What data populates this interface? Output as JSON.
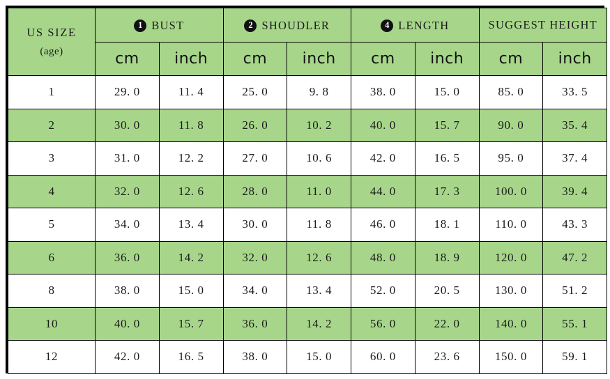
{
  "table": {
    "title": "US SIZE chart",
    "accent_color": "#a7d68b",
    "border_color": "#000000",
    "text_color": "#1a1a1a",
    "size_column": {
      "line1": "US SIZE",
      "line2": "(age)"
    },
    "measurement_groups": [
      {
        "badge": "1",
        "label": "BUST"
      },
      {
        "badge": "2",
        "label": "SHOUDLER"
      },
      {
        "badge": "4",
        "label": "LENGTH"
      },
      {
        "badge": "",
        "label": "SUGGEST HEIGHT"
      }
    ],
    "unit_headers": [
      "cm",
      "inch",
      "cm",
      "inch",
      "cm",
      "inch",
      "cm",
      "inch"
    ],
    "rows": [
      {
        "size": "1",
        "striped": false,
        "values": [
          "29. 0",
          "11. 4",
          "25. 0",
          "9. 8",
          "38. 0",
          "15. 0",
          "85. 0",
          "33. 5"
        ]
      },
      {
        "size": "2",
        "striped": true,
        "values": [
          "30. 0",
          "11. 8",
          "26. 0",
          "10. 2",
          "40. 0",
          "15. 7",
          "90. 0",
          "35. 4"
        ]
      },
      {
        "size": "3",
        "striped": false,
        "values": [
          "31. 0",
          "12. 2",
          "27. 0",
          "10. 6",
          "42. 0",
          "16. 5",
          "95. 0",
          "37. 4"
        ]
      },
      {
        "size": "4",
        "striped": true,
        "values": [
          "32. 0",
          "12. 6",
          "28. 0",
          "11. 0",
          "44. 0",
          "17. 3",
          "100. 0",
          "39. 4"
        ]
      },
      {
        "size": "5",
        "striped": false,
        "values": [
          "34. 0",
          "13. 4",
          "30. 0",
          "11. 8",
          "46. 0",
          "18. 1",
          "110. 0",
          "43. 3"
        ]
      },
      {
        "size": "6",
        "striped": true,
        "values": [
          "36. 0",
          "14. 2",
          "32. 0",
          "12. 6",
          "48. 0",
          "18. 9",
          "120. 0",
          "47. 2"
        ]
      },
      {
        "size": "8",
        "striped": false,
        "values": [
          "38. 0",
          "15. 0",
          "34. 0",
          "13. 4",
          "52. 0",
          "20. 5",
          "130. 0",
          "51. 2"
        ]
      },
      {
        "size": "10",
        "striped": true,
        "values": [
          "40. 0",
          "15. 7",
          "36. 0",
          "14. 2",
          "56. 0",
          "22. 0",
          "140. 0",
          "55. 1"
        ]
      },
      {
        "size": "12",
        "striped": false,
        "values": [
          "42. 0",
          "16. 5",
          "38. 0",
          "15. 0",
          "60. 0",
          "23. 6",
          "150. 0",
          "59. 1"
        ]
      }
    ]
  },
  "chart_data": {
    "type": "table",
    "title": "US SIZE chart",
    "columns": [
      "US SIZE (age)",
      "BUST cm",
      "BUST inch",
      "SHOUDLER cm",
      "SHOUDLER inch",
      "LENGTH cm",
      "LENGTH inch",
      "SUGGEST HEIGHT cm",
      "SUGGEST HEIGHT inch"
    ],
    "rows": [
      [
        "1",
        29.0,
        11.4,
        25.0,
        9.8,
        38.0,
        15.0,
        85.0,
        33.5
      ],
      [
        "2",
        30.0,
        11.8,
        26.0,
        10.2,
        40.0,
        15.7,
        90.0,
        35.4
      ],
      [
        "3",
        31.0,
        12.2,
        27.0,
        10.6,
        42.0,
        16.5,
        95.0,
        37.4
      ],
      [
        "4",
        32.0,
        12.6,
        28.0,
        11.0,
        44.0,
        17.3,
        100.0,
        39.4
      ],
      [
        "5",
        34.0,
        13.4,
        30.0,
        11.8,
        46.0,
        18.1,
        110.0,
        43.3
      ],
      [
        "6",
        36.0,
        14.2,
        32.0,
        12.6,
        48.0,
        18.9,
        120.0,
        47.2
      ],
      [
        "8",
        38.0,
        15.0,
        34.0,
        13.4,
        52.0,
        20.5,
        130.0,
        51.2
      ],
      [
        "10",
        40.0,
        15.7,
        36.0,
        14.2,
        56.0,
        22.0,
        140.0,
        55.1
      ],
      [
        "12",
        42.0,
        16.5,
        38.0,
        15.0,
        60.0,
        23.6,
        150.0,
        59.1
      ]
    ]
  }
}
